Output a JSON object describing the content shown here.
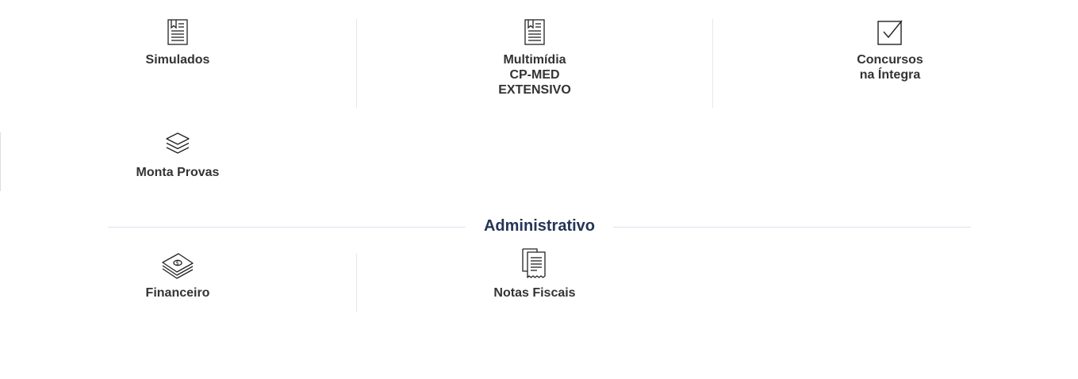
{
  "menu": {
    "items": [
      {
        "label": "Simulados",
        "icon": "exam-book-icon"
      },
      {
        "label": "Multimídia\nCP-MED\nEXTENSIVO",
        "icon": "multimedia-book-icon"
      },
      {
        "label": "Concursos\nna Íntegra",
        "icon": "checkbox-icon"
      },
      {
        "label": "Monta Provas",
        "icon": "layers-icon"
      }
    ]
  },
  "admin": {
    "title": "Administrativo",
    "items": [
      {
        "label": "Financeiro",
        "icon": "money-stack-icon"
      },
      {
        "label": "Notas Fiscais",
        "icon": "receipts-icon"
      }
    ]
  },
  "colors": {
    "text": "#333333",
    "section_title": "#243657",
    "divider": "#e6e6ee"
  }
}
